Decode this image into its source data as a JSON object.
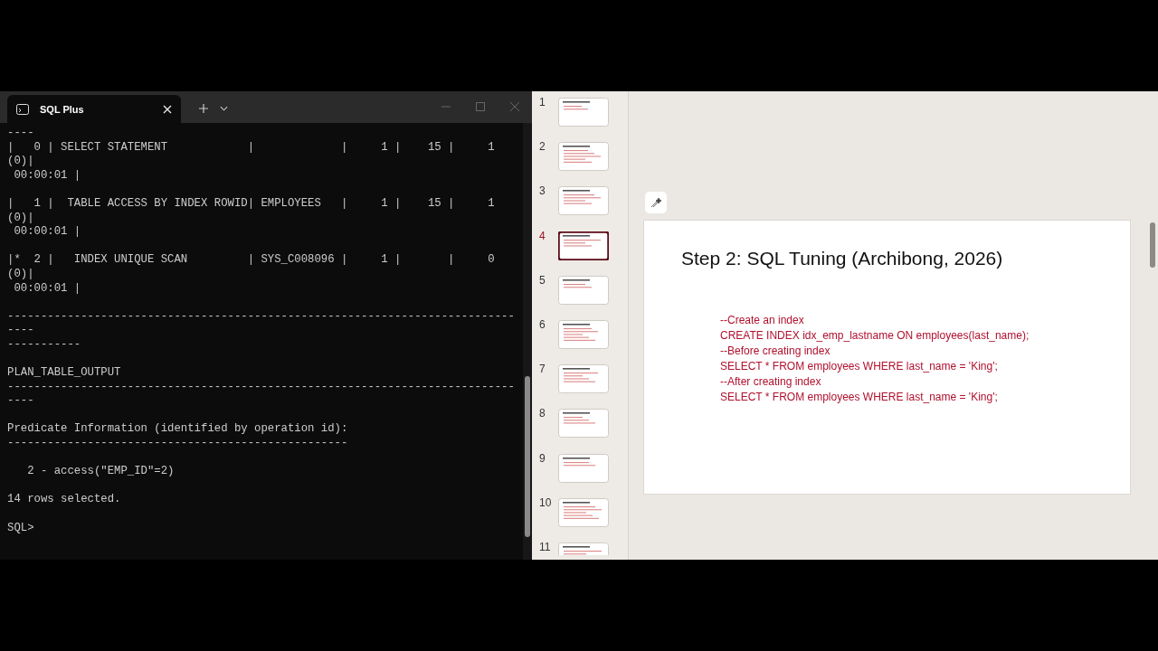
{
  "terminal": {
    "tab_title": "SQL Plus",
    "blocks": [
      [
        "----",
        "|   0 | SELECT STATEMENT            |             |     1 |    15 |     1",
        "(0)|",
        " 00:00:01 |"
      ],
      [
        "|   1 |  TABLE ACCESS BY INDEX ROWID| EMPLOYEES   |     1 |    15 |     1",
        "(0)|",
        " 00:00:01 |"
      ],
      [
        "|*  2 |   INDEX UNIQUE SCAN         | SYS_C008096 |     1 |       |     0",
        "(0)|",
        " 00:00:01 |"
      ],
      [
        "----------------------------------------------------------------------------",
        "----",
        "-----------"
      ],
      [
        "PLAN_TABLE_OUTPUT",
        "----------------------------------------------------------------------------",
        "----"
      ],
      [
        "Predicate Information (identified by operation id):",
        "---------------------------------------------------"
      ],
      [
        "   2 - access(\"EMP_ID\"=2)"
      ],
      [
        "14 rows selected."
      ],
      [
        "SQL>"
      ]
    ]
  },
  "slides": {
    "thumbnails": [
      {
        "number": "1",
        "selected": false
      },
      {
        "number": "2",
        "selected": false
      },
      {
        "number": "3",
        "selected": false
      },
      {
        "number": "4",
        "selected": true
      },
      {
        "number": "5",
        "selected": false
      },
      {
        "number": "6",
        "selected": false
      },
      {
        "number": "7",
        "selected": false
      },
      {
        "number": "8",
        "selected": false
      },
      {
        "number": "9",
        "selected": false
      },
      {
        "number": "10",
        "selected": false
      },
      {
        "number": "11",
        "selected": false
      }
    ],
    "current": {
      "title": "Step 2: SQL Tuning (Archibong, 2026)",
      "lines": [
        "--Create an index",
        "CREATE INDEX idx_emp_lastname ON employees(last_name);",
        "--Before creating index",
        "SELECT * FROM employees WHERE last_name = 'King';",
        "--After creating index",
        "SELECT * FROM employees WHERE last_name = 'King';"
      ]
    }
  }
}
